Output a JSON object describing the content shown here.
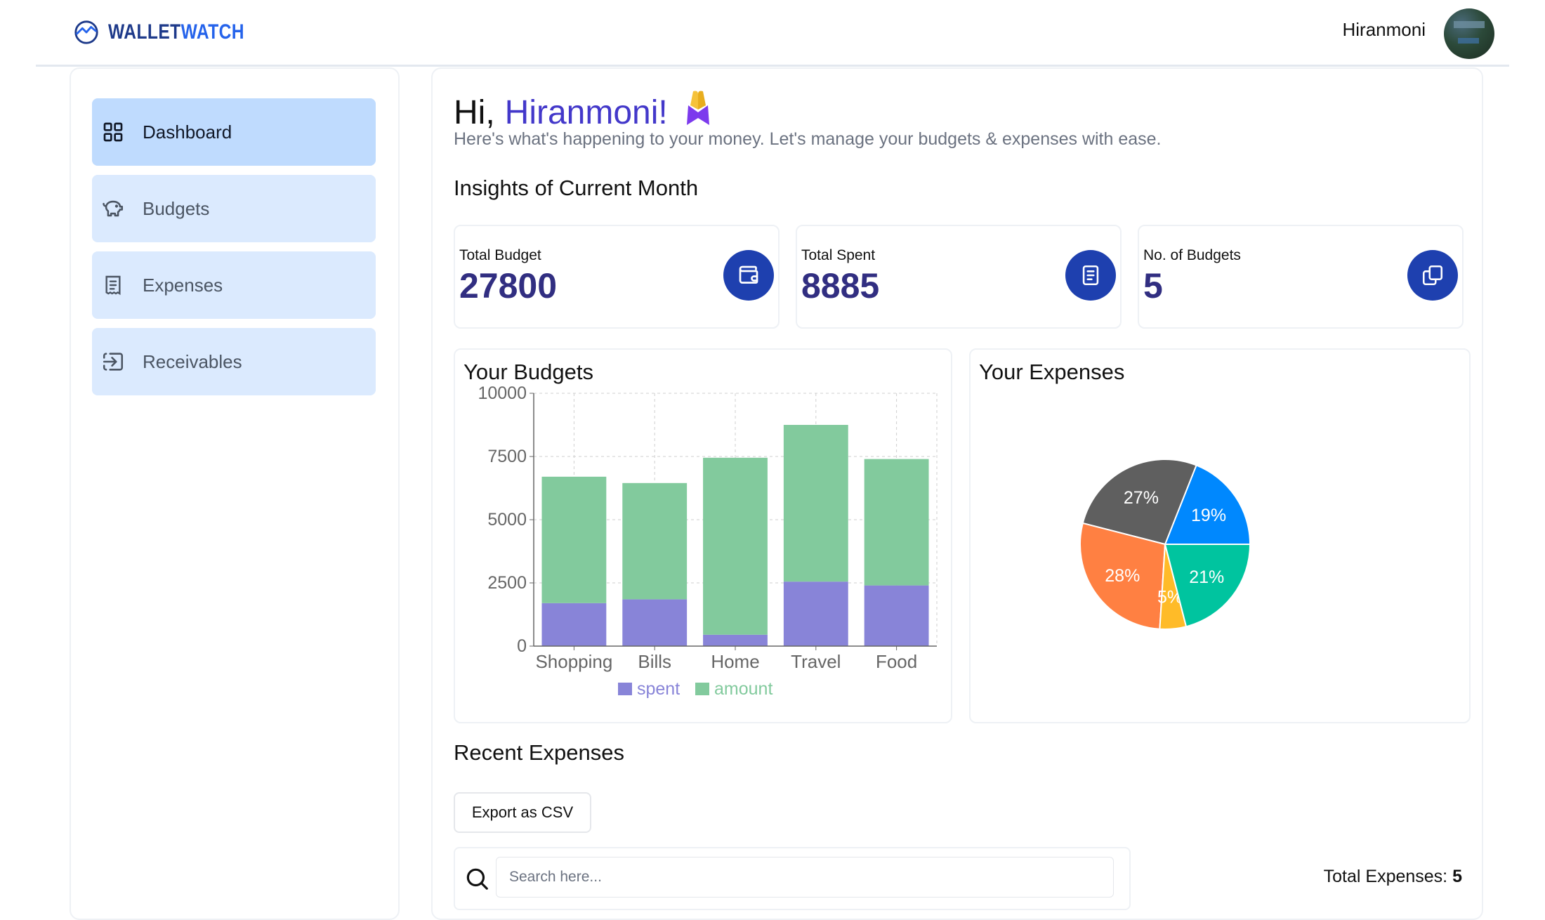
{
  "header": {
    "brand_part1": "WALLET",
    "brand_part2": "WATCH",
    "username": "Hiranmoni"
  },
  "sidebar": {
    "items": [
      {
        "label": "Dashboard",
        "icon": "dashboard-grid-icon",
        "active": true
      },
      {
        "label": "Budgets",
        "icon": "piggy-bank-icon",
        "active": false
      },
      {
        "label": "Expenses",
        "icon": "receipt-icon",
        "active": false
      },
      {
        "label": "Receivables",
        "icon": "import-icon",
        "active": false
      }
    ]
  },
  "main": {
    "greeting_prefix": "Hi,",
    "greeting_name": "Hiranmoni!",
    "greeting_emoji": "🙏",
    "subtitle": "Here's what's happening to your money. Let's manage your budgets & expenses with ease.",
    "insights_title": "Insights of Current Month",
    "stats": [
      {
        "label": "Total Budget",
        "value": "27800",
        "icon": "wallet-icon"
      },
      {
        "label": "Total Spent",
        "value": "8885",
        "icon": "receipt-icon"
      },
      {
        "label": "No. of Budgets",
        "value": "5",
        "icon": "copy-stack-icon"
      }
    ],
    "budgets_title": "Your Budgets",
    "expenses_title": "Your Expenses",
    "recent_title": "Recent Expenses",
    "export_label": "Export as CSV",
    "search_placeholder": "Search here...",
    "total_expenses_label": "Total Expenses:",
    "total_expenses_value": "5"
  },
  "colors": {
    "brand_dark": "#1e3a8a",
    "accent_purple": "#4338ca",
    "icon_button": "#1e40af",
    "spent": "#8884d8",
    "amount": "#82ca9d"
  },
  "chart_data": [
    {
      "type": "bar",
      "stacked": true,
      "categories": [
        "Shopping",
        "Bills",
        "Home",
        "Travel",
        "Food"
      ],
      "series": [
        {
          "name": "spent",
          "values": [
            1700,
            1850,
            450,
            2550,
            2400
          ],
          "color": "#8884d8"
        },
        {
          "name": "amount",
          "values": [
            5000,
            4600,
            7000,
            6200,
            5000
          ],
          "color": "#82ca9d"
        }
      ],
      "yticks": [
        0,
        2500,
        5000,
        7500,
        10000
      ],
      "ylim": [
        0,
        10000
      ],
      "grid": true,
      "legend": "bottom"
    },
    {
      "type": "pie",
      "slices": [
        {
          "label": "19%",
          "value": 19,
          "color": "#0088fe"
        },
        {
          "label": "27%",
          "value": 27,
          "color": "#5f5f5f"
        },
        {
          "label": "28%",
          "value": 28,
          "color": "#ff8042"
        },
        {
          "label": "5%",
          "value": 5,
          "color": "#ffbb28"
        },
        {
          "label": "21%",
          "value": 21,
          "color": "#00c49f"
        }
      ],
      "legend": "none"
    }
  ]
}
